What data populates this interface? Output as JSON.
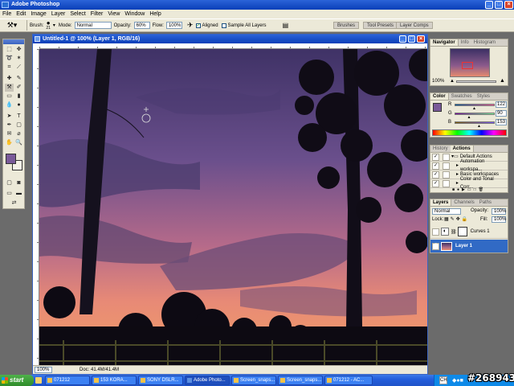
{
  "app": {
    "title": "Adobe Photoshop"
  },
  "menu": [
    "File",
    "Edit",
    "Image",
    "Layer",
    "Select",
    "Filter",
    "View",
    "Window",
    "Help"
  ],
  "options": {
    "brush_label": "Brush:",
    "brush_size": "21",
    "mode_label": "Mode:",
    "mode_value": "Normal",
    "opacity_label": "Opacity:",
    "opacity_value": "60%",
    "flow_label": "Flow:",
    "flow_value": "100%",
    "aligned_label": "Aligned",
    "sample_all_label": "Sample All Layers",
    "well_tabs": [
      "Brushes",
      "Tool Presets",
      "Layer Comps"
    ]
  },
  "document": {
    "title": "Untitled-1 @ 100% (Layer 1, RGB/16)",
    "zoom": "100%",
    "doc_info": "Doc: 41.4M/41.4M"
  },
  "navigator": {
    "tabs": [
      "Navigator",
      "Info",
      "Histogram"
    ],
    "zoom": "100%"
  },
  "color_panel": {
    "tabs": [
      "Color",
      "Swatches",
      "Styles"
    ],
    "channels": [
      {
        "label": "R",
        "value": "122",
        "level": 0.48
      },
      {
        "label": "G",
        "value": "90",
        "level": 0.35
      },
      {
        "label": "B",
        "value": "153",
        "level": 0.6
      }
    ],
    "foreground": "#7a5a99"
  },
  "actions_panel": {
    "tabs": [
      "History",
      "Actions"
    ],
    "items": [
      "Default Actions",
      "Automation workspa...",
      "Basic workspaces",
      "Color and Tonal Corr..."
    ]
  },
  "layers_panel": {
    "tabs": [
      "Layers",
      "Channels",
      "Paths"
    ],
    "blend_mode": "Normal",
    "opacity_label": "Opacity:",
    "opacity_value": "100%",
    "lock_label": "Lock:",
    "fill_label": "Fill:",
    "fill_value": "100%",
    "layers": [
      {
        "name": "Curves 1",
        "selected": false
      },
      {
        "name": "Layer 1",
        "selected": true
      }
    ]
  },
  "taskbar": {
    "start": "start",
    "tasks": [
      "071212",
      "153 KORA...",
      "SONY DSLR...",
      "Adobe Photo...",
      "Screen_snaps...",
      "Screen_snaps...",
      "071212 - AC..."
    ],
    "watermark": "#268943"
  }
}
